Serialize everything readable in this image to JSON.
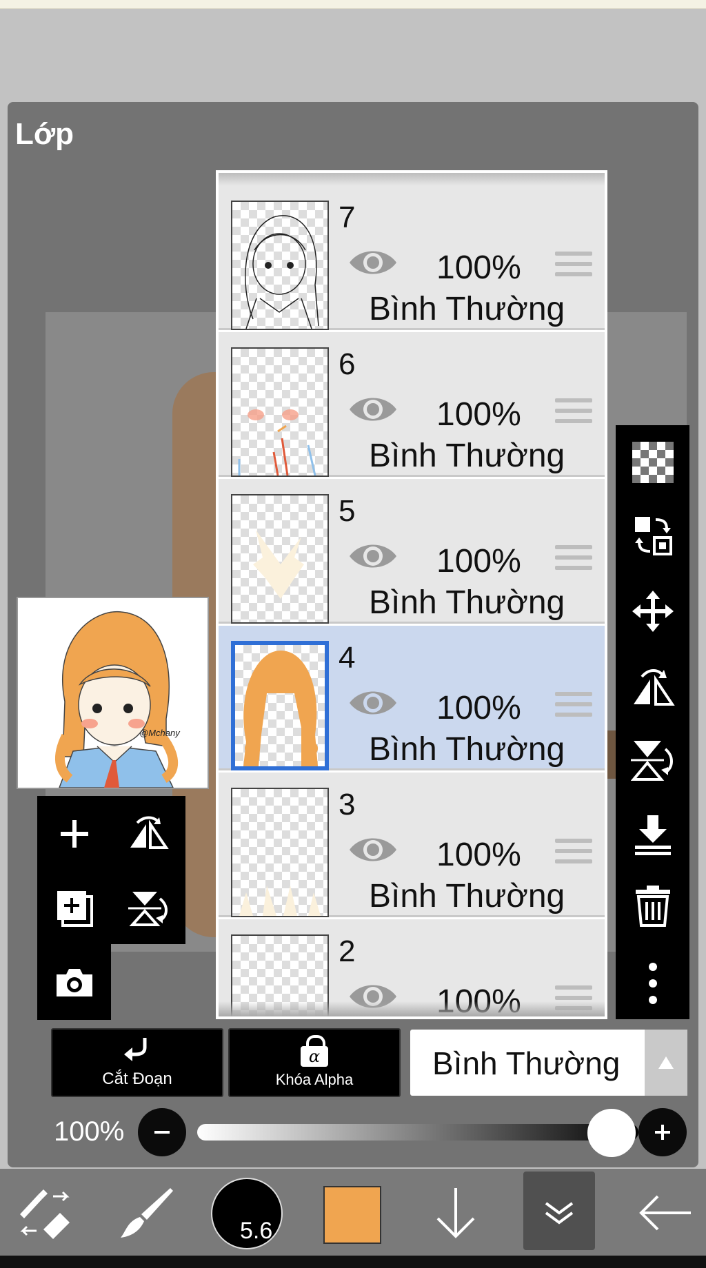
{
  "panel": {
    "title": "Lớp"
  },
  "layers": [
    {
      "number": "7",
      "opacity": "100%",
      "mode": "Bình Thường",
      "selected": false
    },
    {
      "number": "6",
      "opacity": "100%",
      "mode": "Bình Thường",
      "selected": false
    },
    {
      "number": "5",
      "opacity": "100%",
      "mode": "Bình Thường",
      "selected": false
    },
    {
      "number": "4",
      "opacity": "100%",
      "mode": "Bình Thường",
      "selected": true
    },
    {
      "number": "3",
      "opacity": "100%",
      "mode": "Bình Thường",
      "selected": false
    },
    {
      "number": "2",
      "opacity": "100%",
      "mode": "",
      "selected": false
    }
  ],
  "preview": {
    "signature": "@Mchany"
  },
  "actions": {
    "clipping_label": "Cắt Đoạn",
    "alpha_lock_label": "Khóa Alpha",
    "alpha_symbol": "α"
  },
  "blend_mode": {
    "value": "Bình Thường"
  },
  "opacity": {
    "label": "100%",
    "value_percent": 100
  },
  "toolbar": {
    "brush_size": "5.6",
    "color": "#f0a550"
  },
  "colors": {
    "selected_layer_bg": "#cbd8ee",
    "selection_border": "#2f6fd6",
    "hair_orange": "#f0a550"
  }
}
